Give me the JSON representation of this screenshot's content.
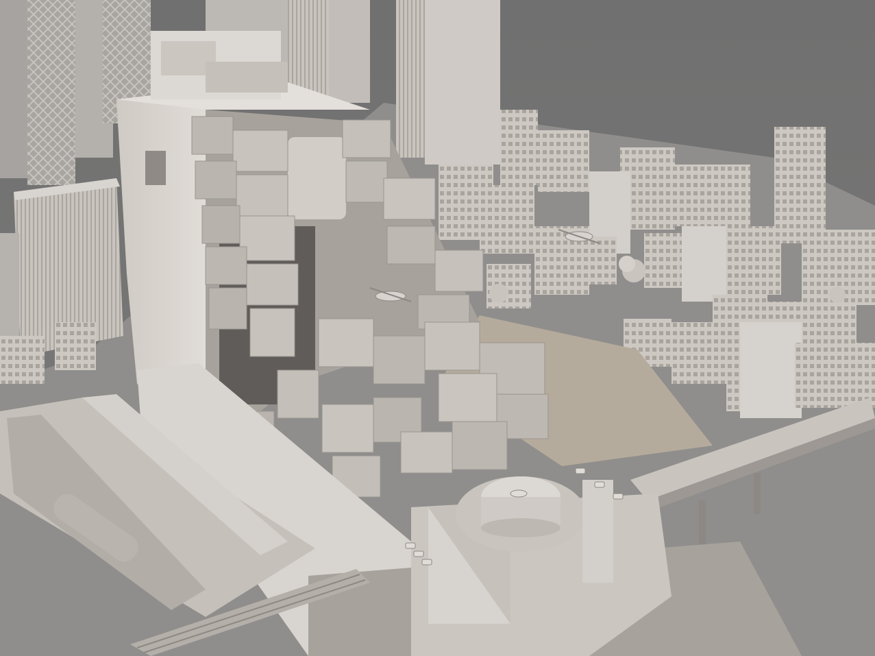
{
  "scene": {
    "palette": {
      "sky": "#6e6e6e",
      "ground": "#8e8d8b",
      "concrete_light": "#d8d4cf",
      "concrete_mid": "#bdb8b2",
      "concrete_dark": "#9a9590",
      "shadow": "#5f5c59",
      "sand": "#b7ad9e"
    },
    "features": [
      "megastructure-tower",
      "modular-cube-cluster",
      "rooftop-helipad",
      "parked-vehicles",
      "elevated-highway",
      "city-block-buildings",
      "background-skyscrapers",
      "helicopters",
      "trees"
    ]
  }
}
